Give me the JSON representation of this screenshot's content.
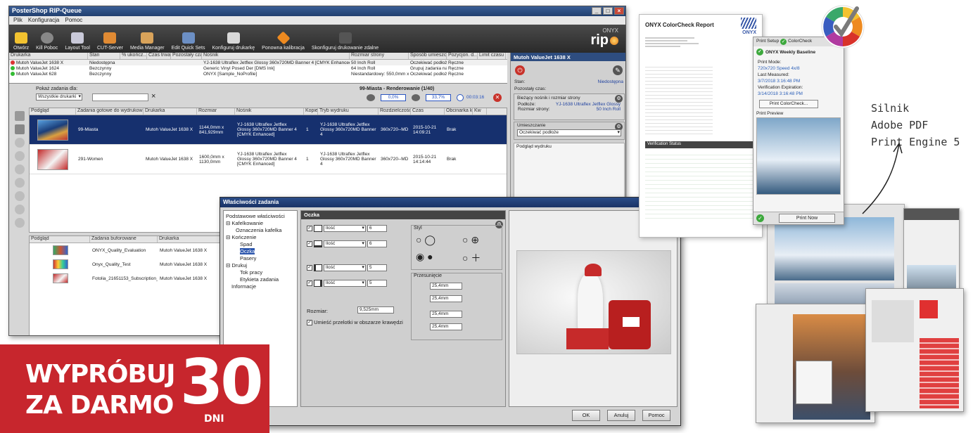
{
  "rip": {
    "title": "PosterShop RIP-Queue",
    "menu": [
      "Plik",
      "Konfiguracja",
      "Pomoc"
    ],
    "toolbar": [
      "Otwórz",
      "Kill Poboc",
      "Layout Tool",
      "CUT-Server",
      "Media Manager",
      "Edit Quick Sets",
      "Konfiguruj drukarkę",
      "Ponowna kalibracja",
      "Skonfiguruj drukowanie zdalne"
    ],
    "logo_small": "ONYX",
    "logo_big": "rip",
    "printer_headers": [
      "Drukarka",
      "Stan",
      "% ukończ...",
      "Czas trwania",
      "Pozostały czas",
      "Nośnik",
      "Rozmiar strony",
      "Sposób umieszcza...",
      "Pozycjon. d...",
      "Limit czasu"
    ],
    "printers": [
      {
        "name": "Mutoh ValueJet 1638 X",
        "state": "Niedostępna",
        "media": "YJ-1638 Ultraflex Jetflex Glossy 360x720MD Banner 4 [CMYK Enhanced]",
        "size": "50 Inch Roll",
        "place": "Oczekiwać podłoże",
        "pos": "Ręczne"
      },
      {
        "name": "Mutoh ValueJet 1624",
        "state": "Bezczynny",
        "media": "Generic Vinyl Posed Der [DMS Ink]",
        "size": "64 Inch Roll",
        "place": "Grupuj zadania na...",
        "pos": "Ręczne"
      },
      {
        "name": "Mutoh ValueJet 628",
        "state": "Bezczynny",
        "media": "ONYX [Sample_NoProfile]",
        "size": "Niestandardowy: 550,0mm x...",
        "place": "Oczekiwać podłoże",
        "pos": "Ręczne"
      }
    ],
    "filter_label": "Pokaż zadania dla:",
    "filter_value": "Wszystkie drukarki",
    "render_label": "99-Miasta - Renderowanie (1/40)",
    "render_pct1": "0,0%",
    "render_pct2": "33,7%",
    "render_time": "00:03:16",
    "job_headers": [
      "Podgląd",
      "Zadania gotowe do wydrukowania",
      "Drukarka",
      "Rozmiar",
      "Nośnik",
      "Kopie",
      "Tryb wydruku",
      "Rozdzielczość",
      "Czas",
      "Obcinarka ko...",
      "Kw"
    ],
    "jobs": [
      {
        "name": "99-Miasta",
        "printer": "Mutoh ValueJet 1638 X",
        "size": "1144,0mm x 841,929mm",
        "media": "YJ-1638 Ultraflex Jetflex Glossy 360x720MD Banner 4 [CMYK Enhanced]",
        "copies": "1",
        "mode": "YJ-1638 Ultraflex Jetflex Glossy 360x720MD Banner 4",
        "res": "360x720--MD",
        "time": "2015-10-21 14:09:21",
        "cut": "Brak"
      },
      {
        "name": "291-Women",
        "printer": "Mutoh ValueJet 1638 X",
        "size": "1600,0mm x 1130,0mm",
        "media": "YJ-1638 Ultraflex Jetflex Glossy 360x720MD Banner 4 [CMYK Enhanced]",
        "copies": "1",
        "mode": "YJ-1638 Ultraflex Jetflex Glossy 360x720MD Banner 4",
        "res": "360x720--MD",
        "time": "2015-10-21 14:14:44",
        "cut": "Brak"
      }
    ],
    "queue_headers": [
      "Podgląd",
      "Zadania buforowane",
      "Drukarka"
    ],
    "queue": [
      {
        "name": "ONYX_Quality_Evaluation",
        "printer": "Mutoh ValueJet 1638 X"
      },
      {
        "name": "Onyx_Quality_Test",
        "printer": "Mutoh ValueJet 1638 X"
      },
      {
        "name": "Fotolia_21651153_Subscription_XL_-...",
        "printer": "Mutoh ValueJet 1638 X"
      }
    ],
    "panel": {
      "title": "Mutoh ValueJet 1638 X",
      "state_label": "Stan:",
      "state_value": "Niedostępna",
      "remaining_label": "Pozostały czas:",
      "media_label": "Bieżący nośnik i rozmiar strony",
      "podloze_label": "Podłoże:",
      "podloze_value": "YJ-1638 Ultraflex Jetflex Glossy",
      "page_label": "Rozmiar strony:",
      "page_value": "50 Inch Roll",
      "place_label": "Umieszczanie",
      "place_value": "Oczekiwać podłoże",
      "preview_label": "Podgląd wydruku"
    }
  },
  "dialog": {
    "title": "Właściwości zadania",
    "tree": [
      "Podstawowe właściwości",
      "Kafelkowanie",
      "Oznaczenia kafelka",
      "Kończenie",
      "Spad",
      "Oczka",
      "Pasery",
      "Drukuj",
      "Tok pracy",
      "Etykieta zadania",
      "Informacje"
    ],
    "section_title": "Oczka",
    "rows": [
      {
        "mode": "Ilość",
        "value": "6"
      },
      {
        "mode": "Ilość",
        "value": "6"
      },
      {
        "mode": "Ilość",
        "value": "5"
      },
      {
        "mode": "Ilość",
        "value": "5"
      }
    ],
    "style_label": "Styl",
    "offset_label": "Przesunięcie",
    "offsets": [
      "25,4mm",
      "25,4mm",
      "25,4mm",
      "25,4mm"
    ],
    "size_label": "Rozmiar:",
    "size_value": "9,525mm",
    "place_checkbox": "Umieść przelotki w obszarze krawędzi",
    "ok": "OK",
    "cancel": "Anuluj",
    "help": "Pomoc"
  },
  "badge": {
    "line1": "WYPRÓBUJ",
    "line2": "ZA DARMO",
    "number": "30",
    "unit": "DNI",
    "color": "#c7262d"
  },
  "report": {
    "title": "ONYX ColorCheck Report",
    "brand": "ONYX",
    "status_title": "Verification Status"
  },
  "colorcheck": {
    "tab1": "Print Setup",
    "tab2": "ColorCheck",
    "baseline": "ONYX Weekly Baseline",
    "print_mode_label": "Print Mode:",
    "print_mode_value": "720x720 Speed 4x/8",
    "last_measured_label": "Last Measured:",
    "last_measured_value": "3/7/2018 3:16:48 PM",
    "verification_label": "Verification Expiration:",
    "verification_value": "3/14/2018 3:16:48 PM",
    "btn": "Print ColorCheck...",
    "preview_label": "Print Preview",
    "print_now": "Print Now"
  },
  "silnik": [
    "Silnik",
    "Adobe PDF",
    "Print Engine 5"
  ]
}
